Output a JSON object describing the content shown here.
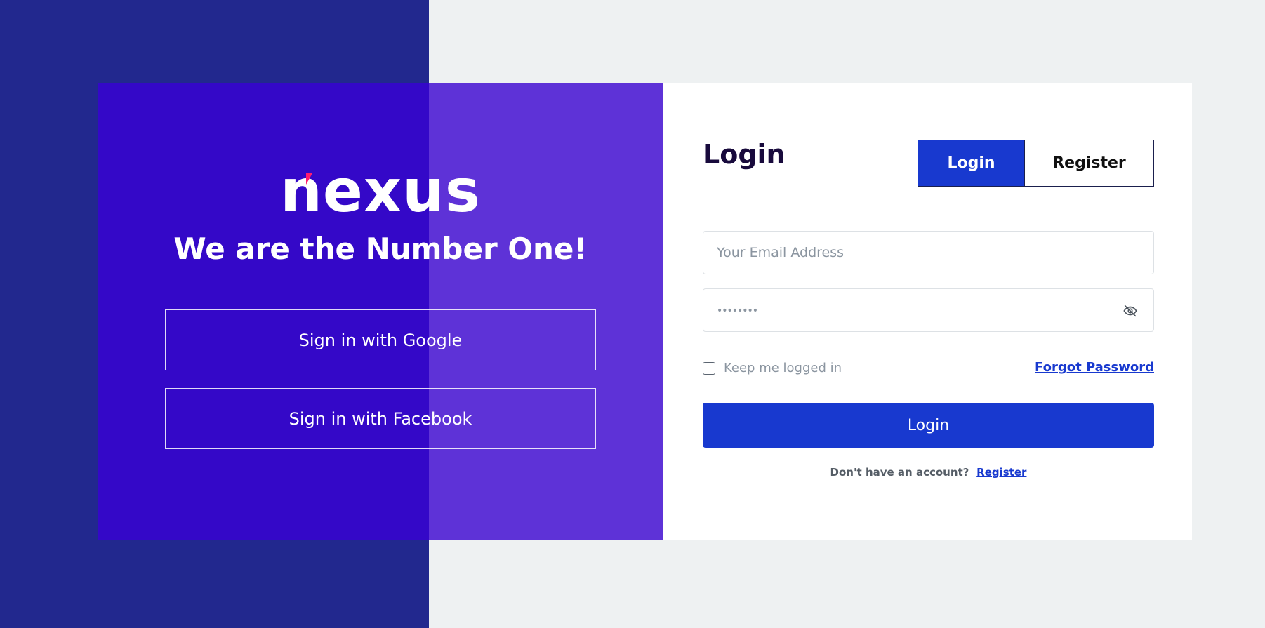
{
  "brand": {
    "logo_text": "nexus",
    "tagline": "We are the Number One!",
    "colors": {
      "page_left": "#22288e",
      "panel": "#5e32d7",
      "panel_shade": "#3408c8",
      "logo_accent": "#ff1c70"
    }
  },
  "social": {
    "google_label": "Sign in with Google",
    "facebook_label": "Sign in with Facebook"
  },
  "form": {
    "title": "Login",
    "tabs": [
      {
        "label": "Login",
        "active": true
      },
      {
        "label": "Register",
        "active": false
      }
    ],
    "email": {
      "placeholder": "Your Email Address",
      "value": ""
    },
    "password": {
      "masked_value": "••••••••",
      "toggle_icon": "eye-off-icon"
    },
    "remember_label": "Keep me logged in",
    "remember_checked": false,
    "forgot_label": "Forgot Password",
    "submit_label": "Login",
    "signup_question": "Don't have an account?",
    "signup_link": "Register",
    "colors": {
      "accent": "#1839cf",
      "title": "#180a3c",
      "muted": "#8b95a0"
    }
  }
}
